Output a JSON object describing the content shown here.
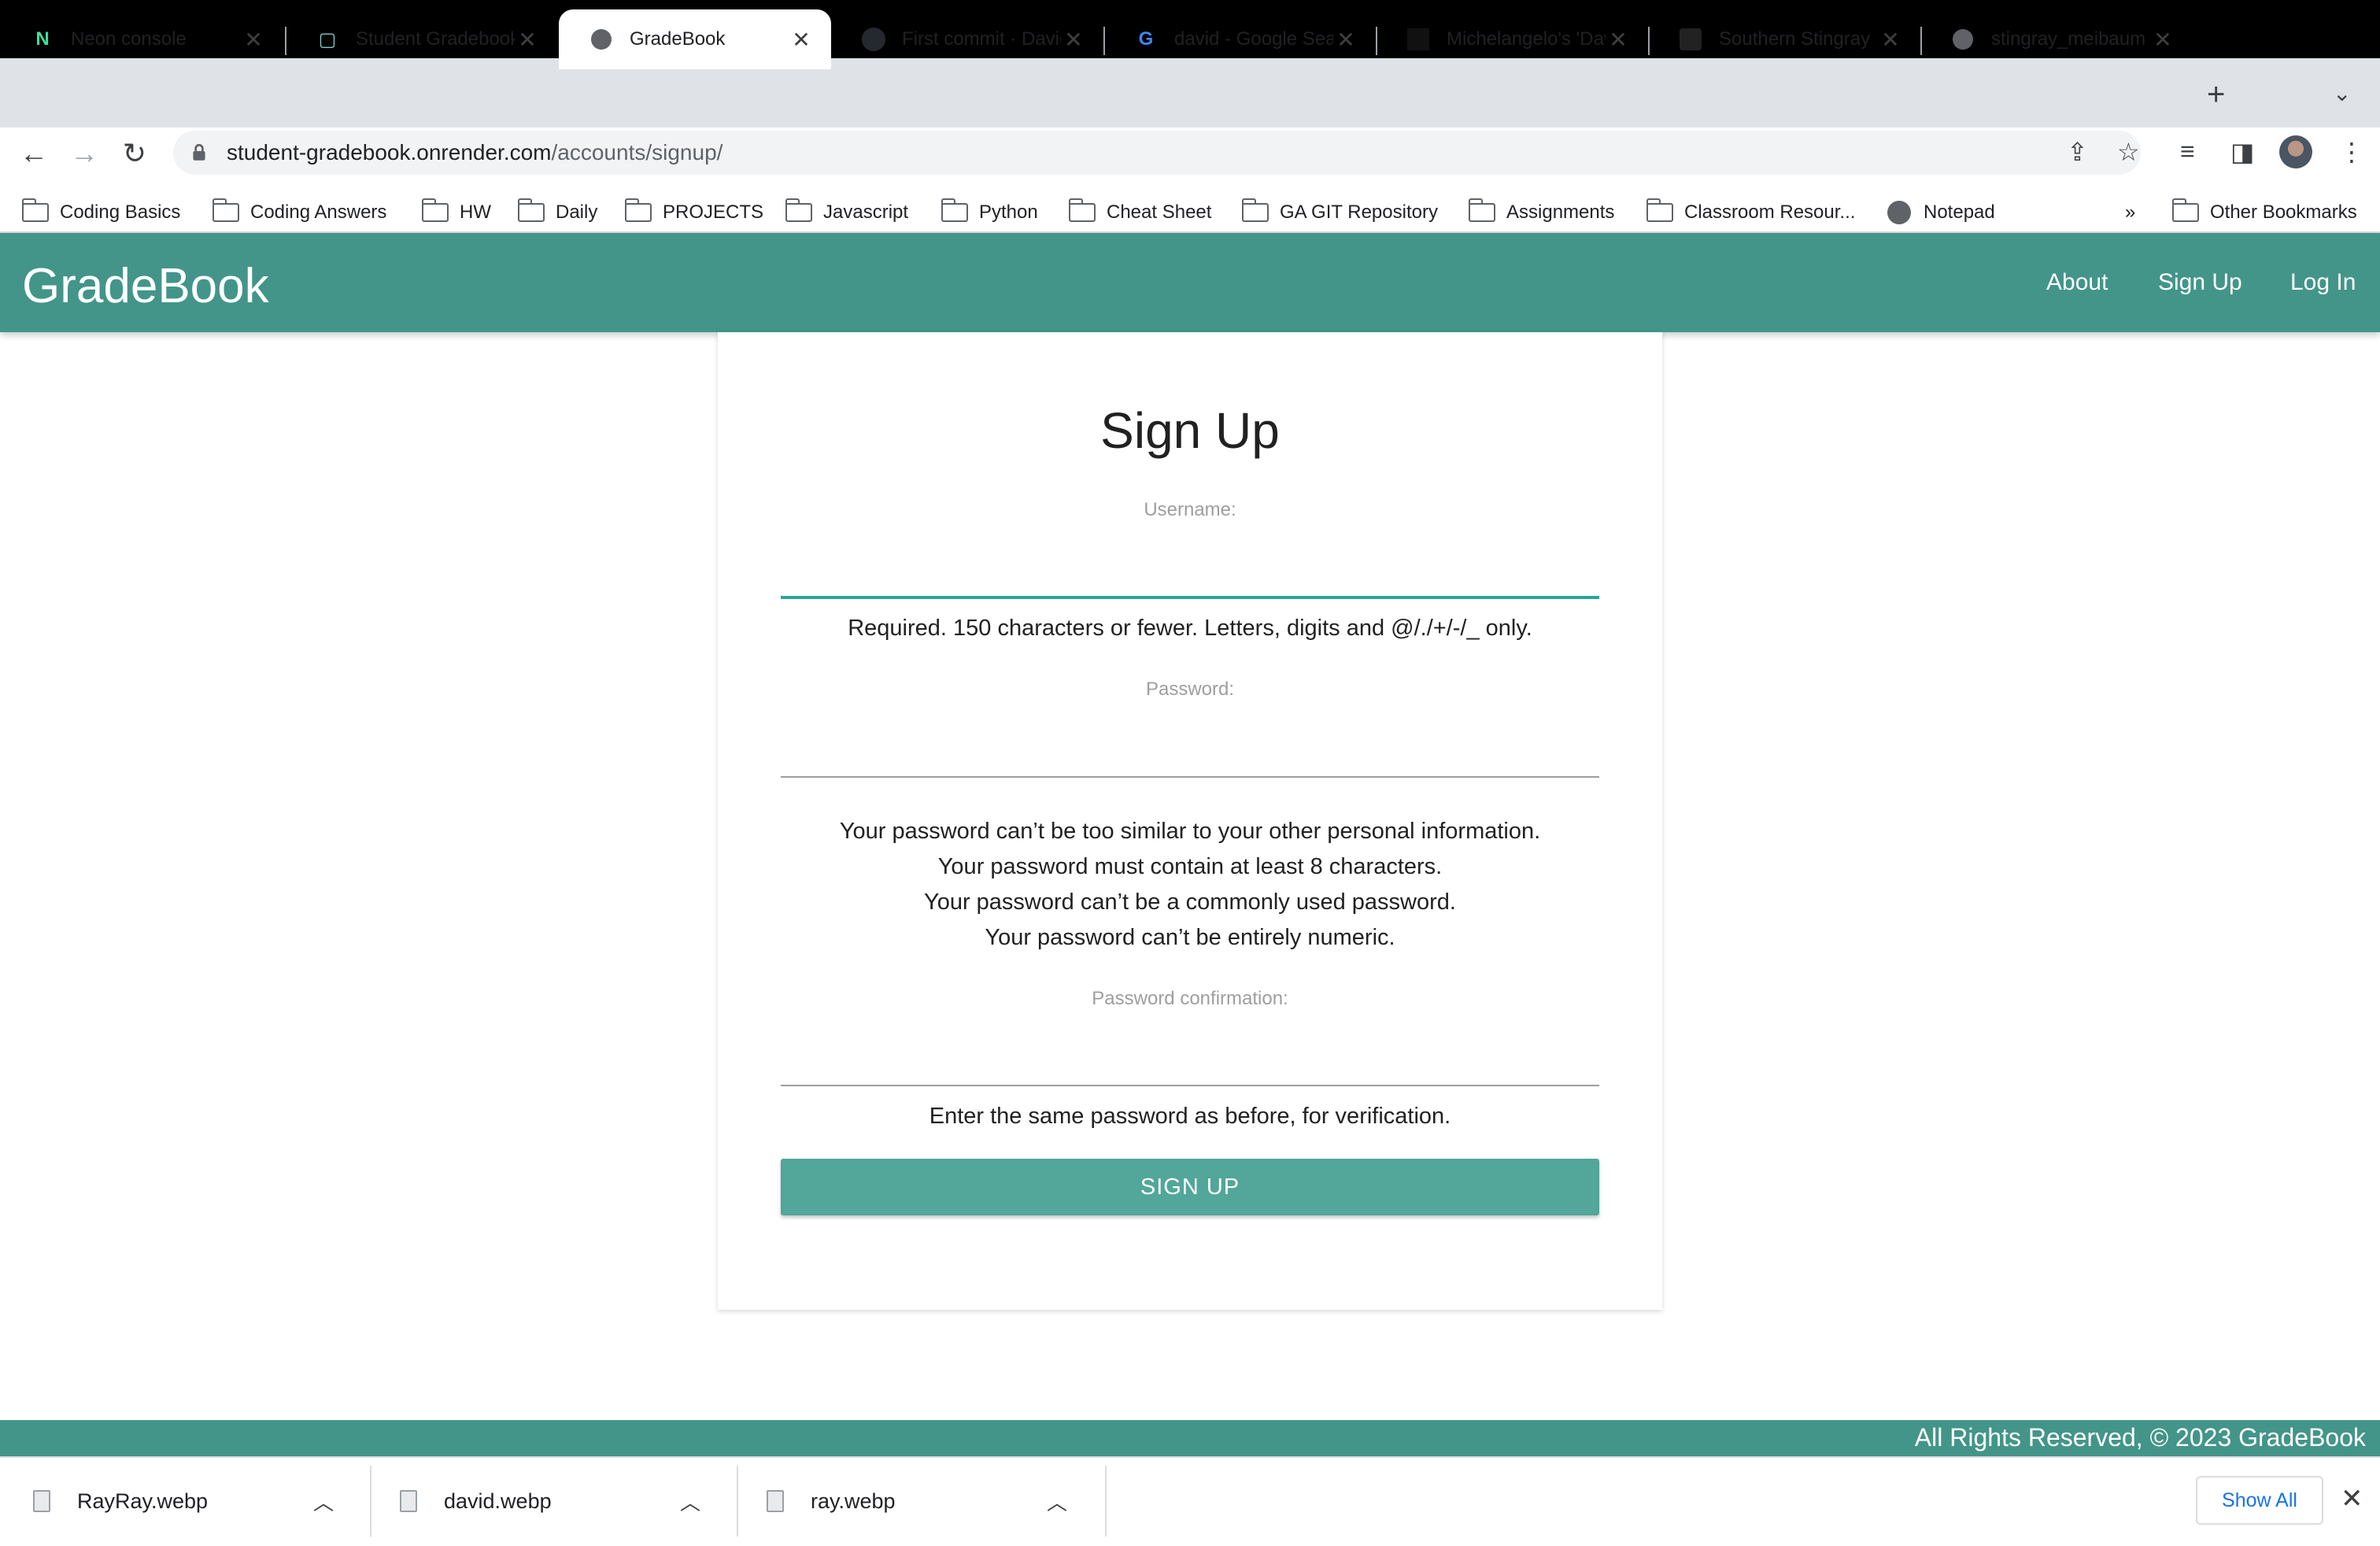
{
  "browser": {
    "tabs": [
      {
        "title": "Neon console",
        "icon": "neon-icon",
        "active": false
      },
      {
        "title": "Student Gradebook",
        "icon": "page-icon",
        "active": false
      },
      {
        "title": "GradeBook",
        "icon": "globe-icon",
        "active": true
      },
      {
        "title": "First commit · David",
        "icon": "github-icon",
        "active": false
      },
      {
        "title": "david - Google Search",
        "icon": "google-icon",
        "active": false
      },
      {
        "title": "Michelangelo's 'David'",
        "icon": "site-icon",
        "active": false
      },
      {
        "title": "Southern Stingray",
        "icon": "site-icon",
        "active": false
      },
      {
        "title": "stingray_meibaum",
        "icon": "globe-icon",
        "active": false
      }
    ],
    "url_host": "student-gradebook.onrender.com",
    "url_path": "/accounts/signup/",
    "bookmarks": [
      "Coding Basics",
      "Coding Answers",
      "HW",
      "Daily",
      "PROJECTS",
      "Javascript",
      "Python",
      "Cheat Sheet",
      "GA GIT Repository",
      "Assignments",
      "Classroom Resour...",
      "Notepad"
    ],
    "bookmarks_overflow": "»",
    "other_bookmarks": "Other Bookmarks"
  },
  "navbar": {
    "brand": "GradeBook",
    "links": [
      "About",
      "Sign Up",
      "Log In"
    ]
  },
  "form": {
    "title": "Sign Up",
    "username_label": "Username:",
    "username_help": "Required. 150 characters or fewer. Letters, digits and @/./+/-/_ only.",
    "password_label": "Password:",
    "password_help": [
      "Your password can’t be too similar to your other personal information.",
      "Your password must contain at least 8 characters.",
      "Your password can’t be a commonly used password.",
      "Your password can’t be entirely numeric."
    ],
    "confirm_label": "Password confirmation:",
    "confirm_help": "Enter the same password as before, for verification.",
    "submit_label": "SIGN UP"
  },
  "footer": {
    "text": "All Rights Reserved, © 2023 GradeBook"
  },
  "downloads": {
    "items": [
      "RayRay.webp",
      "david.webp",
      "ray.webp"
    ],
    "show_all": "Show All"
  },
  "colors": {
    "brand": "#439589",
    "button": "#52a69a",
    "focus": "#26a69a"
  }
}
